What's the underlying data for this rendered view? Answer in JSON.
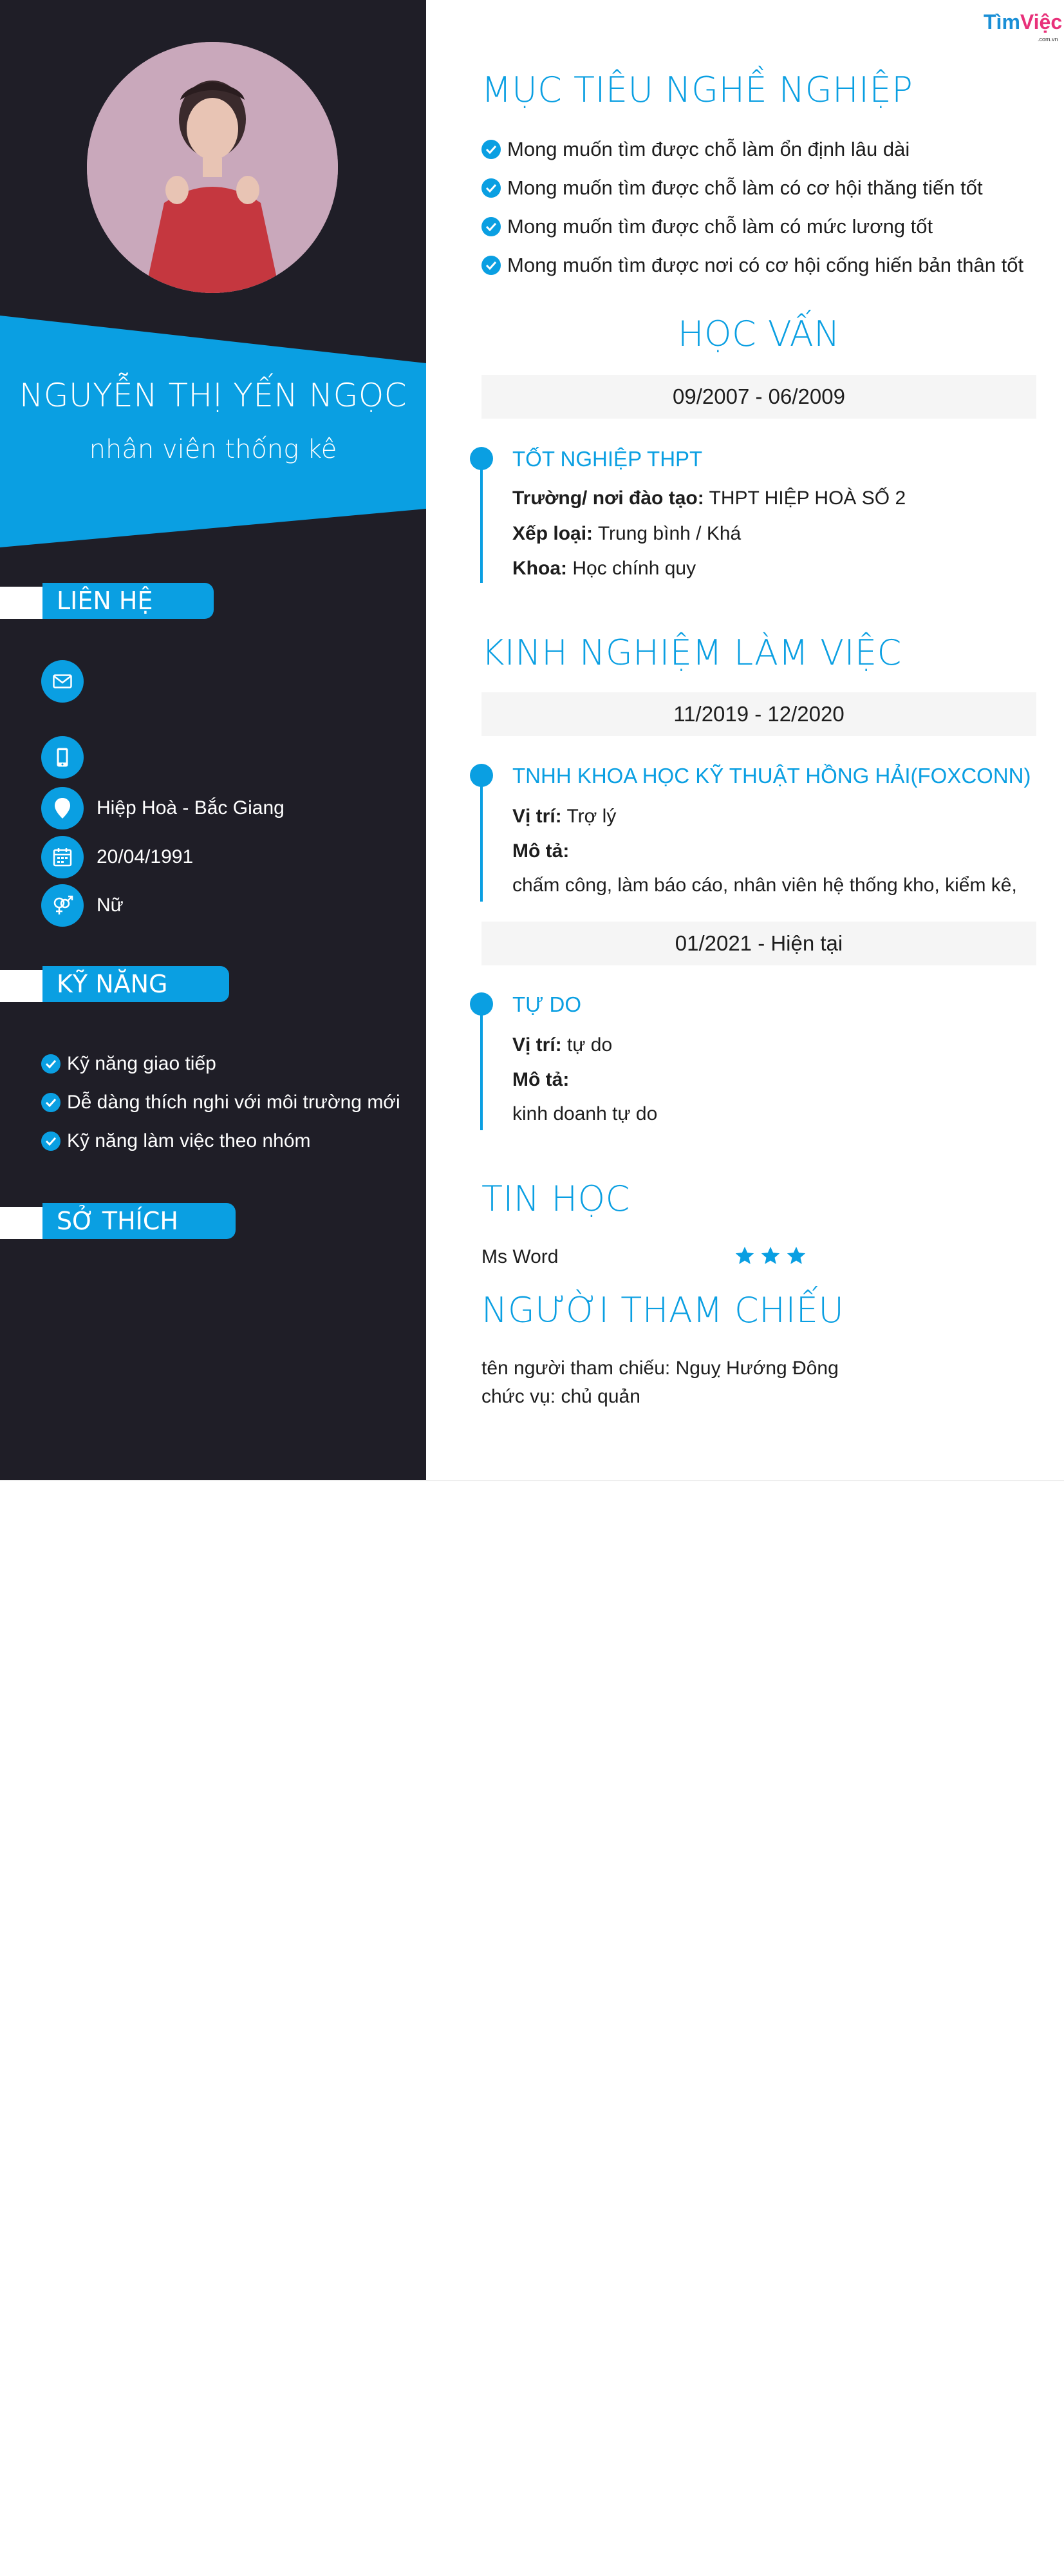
{
  "logo": {
    "part1": "Tìm",
    "part2": "Việc",
    "sub": ".com.vn"
  },
  "profile": {
    "name": "NGUYỄN THỊ YẾN NGỌC",
    "job_title": "nhân viên thống kê"
  },
  "colors": {
    "accent": "#0a9fe2",
    "sidebar": "#1f1e27",
    "date_bar": "#f5f5f5"
  },
  "sidebar": {
    "contact": {
      "heading": "LIÊN HỆ",
      "items": [
        {
          "icon": "envelope-icon",
          "text": ""
        },
        {
          "icon": "phone-icon",
          "text": ""
        },
        {
          "icon": "map-pin-icon",
          "text": "Hiệp Hoà - Bắc Giang"
        },
        {
          "icon": "calendar-icon",
          "text": "20/04/1991"
        },
        {
          "icon": "gender-icon",
          "text": "Nữ"
        }
      ]
    },
    "skills": {
      "heading": "KỸ NĂNG",
      "items": [
        "Kỹ năng giao tiếp",
        "Dễ dàng thích nghi với môi trường mới",
        "Kỹ năng làm việc theo nhóm"
      ]
    },
    "hobbies": {
      "heading": "SỞ THÍCH"
    }
  },
  "objective": {
    "heading": "MỤC TIÊU NGHỀ NGHIỆP",
    "items": [
      "Mong muốn tìm được chỗ làm ổn định lâu dài",
      "Mong muốn tìm được chỗ làm có cơ hội thăng tiến tốt",
      "Mong muốn tìm được chỗ làm có mức lương tốt",
      "Mong muốn tìm được nơi có cơ hội cống hiến bản thân tốt"
    ]
  },
  "education": {
    "heading": "HỌC VẤN",
    "entries": [
      {
        "period": "09/2007 - 06/2009",
        "title": "TỐT NGHIỆP THPT",
        "school_label": "Trường/ nơi đào tạo:",
        "school": "THPT HIỆP HOÀ SỐ 2",
        "rank_label": "Xếp loại:",
        "rank": "Trung bình / Khá",
        "faculty_label": "Khoa:",
        "faculty": "Học chính quy"
      }
    ]
  },
  "experience": {
    "heading": "KINH NGHIỆM LÀM VIỆC",
    "entries": [
      {
        "period": "11/2019 - 12/2020",
        "company": "TNHH KHOA HỌC KỸ THUẬT HỒNG HẢI(FOXCONN)",
        "position_label": "Vị trí:",
        "position": "Trợ lý",
        "desc_label": "Mô tả:",
        "desc": "chấm công, làm báo cáo, nhân viên hệ thống kho, kiểm kê,"
      },
      {
        "period": "01/2021 - Hiện tại",
        "company": "TỰ DO",
        "position_label": "Vị trí:",
        "position": "tự do",
        "desc_label": "Mô tả:",
        "desc": "kinh doanh tự do"
      }
    ]
  },
  "it_skills": {
    "heading": "TIN HỌC",
    "items": [
      {
        "name": "Ms Word",
        "rating": 3
      }
    ]
  },
  "references": {
    "heading": "NGƯỜI THAM CHIẾU",
    "name_line": "tên người tham chiếu: Nguỵ Hướng Đông",
    "role_line": "chức vụ: chủ quản"
  }
}
